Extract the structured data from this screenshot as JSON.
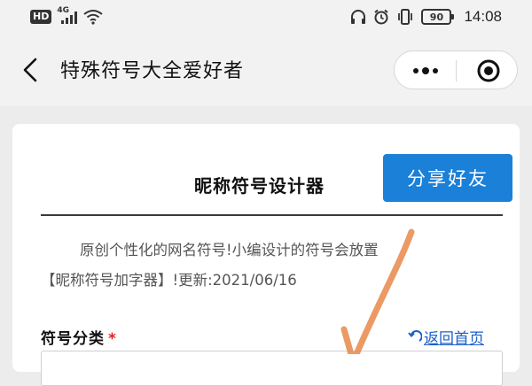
{
  "status_bar": {
    "hd_badge": "HD",
    "network": "4G",
    "battery": "90",
    "time": "14:08",
    "icons": [
      "signal-icon",
      "wifi-icon",
      "headphone-icon",
      "alarm-icon",
      "vibrate-icon",
      "battery-icon"
    ]
  },
  "nav": {
    "title": "特殊符号大全爱好者",
    "icons": [
      "back-arrow-icon",
      "more-dots-icon",
      "close-target-icon"
    ]
  },
  "main": {
    "heading": "昵称符号设计器",
    "share_label": "分享好友",
    "intro_line1": "原创个性化的网名符号!小编设计的符号会放置",
    "intro_line2": "【昵称符号加字器】!更新:2021/06/16",
    "field_label": "符号分类",
    "required_mark": "*",
    "home_link": "返回首页",
    "home_link_icon": "return-arrow-icon"
  },
  "colors": {
    "accent_blue": "#1a80d8",
    "link_blue": "#1a5fc8",
    "required_red": "#e02020",
    "annotation_orange": "#e8884a"
  }
}
